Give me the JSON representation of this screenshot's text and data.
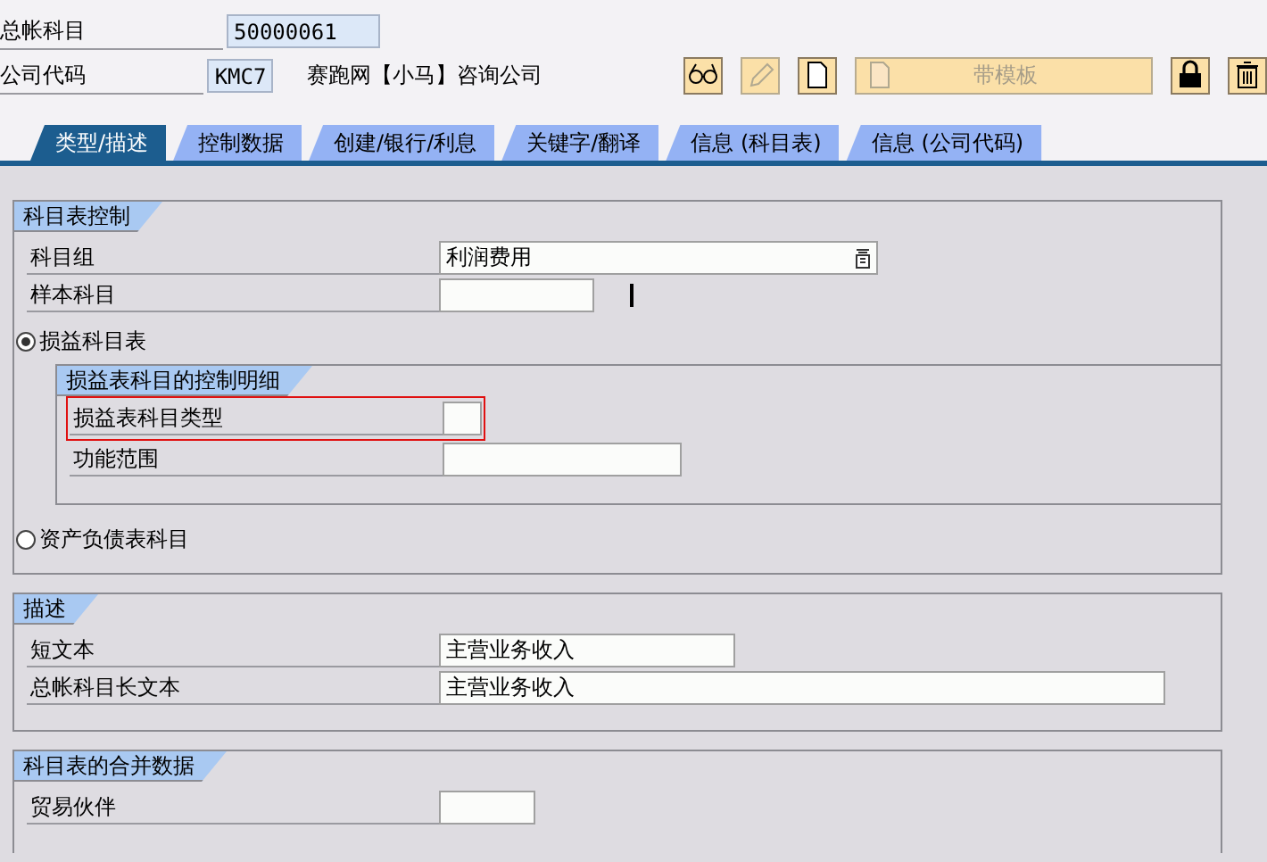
{
  "header": {
    "fields": [
      {
        "label": "总帐科目",
        "value": "50000061"
      },
      {
        "label": "公司代码",
        "value": "KMC7",
        "description": "赛跑网【小马】咨询公司"
      }
    ]
  },
  "toolbar": [
    {
      "kind": "glasses",
      "disabled": false
    },
    {
      "kind": "pencil",
      "disabled": true
    },
    {
      "kind": "document",
      "disabled": false
    },
    {
      "kind": "template",
      "label": "带模板",
      "disabled": true
    },
    {
      "kind": "lock",
      "disabled": false
    },
    {
      "kind": "trash",
      "disabled": false
    }
  ],
  "tabs": [
    {
      "label": "类型/描述",
      "selected": true
    },
    {
      "label": "控制数据",
      "selected": false
    },
    {
      "label": "创建/银行/利息",
      "selected": false
    },
    {
      "label": "关键字/翻译",
      "selected": false
    },
    {
      "label": "信息 (科目表)",
      "selected": false
    },
    {
      "label": "信息 (公司代码)",
      "selected": false
    }
  ],
  "groups": [
    {
      "title": "科目表控制",
      "rows": [
        {
          "kind": "select",
          "label": "科目组",
          "value": "利润费用"
        },
        {
          "kind": "field",
          "label": "样本科目",
          "cursor": true
        },
        {
          "kind": "radio",
          "label": "损益科目表",
          "selected": true
        },
        {
          "kind": "subgroup",
          "title": "损益表科目的控制明细",
          "rows": [
            {
              "kind": "field",
              "label": "损益表科目类型",
              "highlighted": true
            },
            {
              "kind": "field",
              "label": "功能范围"
            }
          ]
        },
        {
          "kind": "radio",
          "label": "资产负债表科目",
          "selected": false
        }
      ]
    },
    {
      "title": "描述",
      "rows": [
        {
          "kind": "field",
          "label": "短文本",
          "value": "主营业务收入"
        },
        {
          "kind": "field",
          "label": "总帐科目长文本",
          "value": "主营业务收入"
        }
      ]
    },
    {
      "title": "科目表的合并数据",
      "rows": [
        {
          "kind": "field",
          "label": "贸易伙伴"
        }
      ]
    }
  ]
}
